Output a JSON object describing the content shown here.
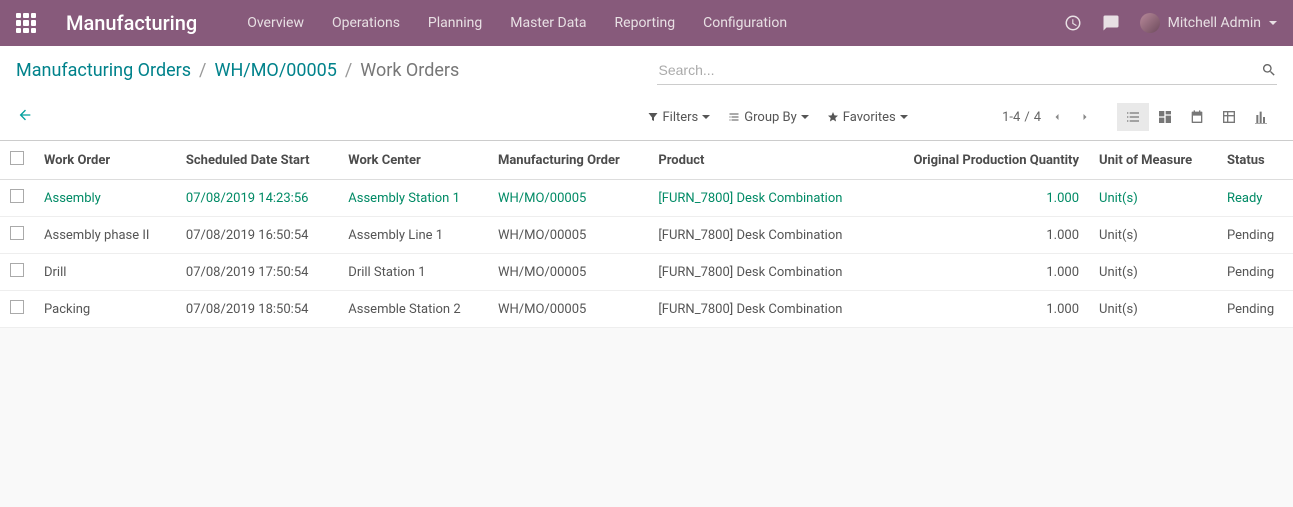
{
  "navbar": {
    "app_title": "Manufacturing",
    "menu": [
      "Overview",
      "Operations",
      "Planning",
      "Master Data",
      "Reporting",
      "Configuration"
    ],
    "user_name": "Mitchell Admin"
  },
  "breadcrumb": {
    "items": [
      "Manufacturing Orders",
      "WH/MO/00005"
    ],
    "current": "Work Orders"
  },
  "search": {
    "placeholder": "Search...",
    "filters_label": "Filters",
    "groupby_label": "Group By",
    "favorites_label": "Favorites"
  },
  "pager": {
    "range": "1-4",
    "sep": " / ",
    "total": "4"
  },
  "table": {
    "headers": {
      "work_order": "Work Order",
      "scheduled": "Scheduled Date Start",
      "work_center": "Work Center",
      "mo": "Manufacturing Order",
      "product": "Product",
      "qty": "Original Production Quantity",
      "uom": "Unit of Measure",
      "status": "Status"
    },
    "rows": [
      {
        "work_order": "Assembly",
        "scheduled": "07/08/2019 14:23:56",
        "work_center": "Assembly Station 1",
        "mo": "WH/MO/00005",
        "product": "[FURN_7800] Desk Combination",
        "qty": "1.000",
        "uom": "Unit(s)",
        "status": "Ready",
        "ready": true
      },
      {
        "work_order": "Assembly phase II",
        "scheduled": "07/08/2019 16:50:54",
        "work_center": "Assembly Line 1",
        "mo": "WH/MO/00005",
        "product": "[FURN_7800] Desk Combination",
        "qty": "1.000",
        "uom": "Unit(s)",
        "status": "Pending",
        "ready": false
      },
      {
        "work_order": "Drill",
        "scheduled": "07/08/2019 17:50:54",
        "work_center": "Drill Station 1",
        "mo": "WH/MO/00005",
        "product": "[FURN_7800] Desk Combination",
        "qty": "1.000",
        "uom": "Unit(s)",
        "status": "Pending",
        "ready": false
      },
      {
        "work_order": "Packing",
        "scheduled": "07/08/2019 18:50:54",
        "work_center": "Assemble Station 2",
        "mo": "WH/MO/00005",
        "product": "[FURN_7800] Desk Combination",
        "qty": "1.000",
        "uom": "Unit(s)",
        "status": "Pending",
        "ready": false
      }
    ]
  }
}
